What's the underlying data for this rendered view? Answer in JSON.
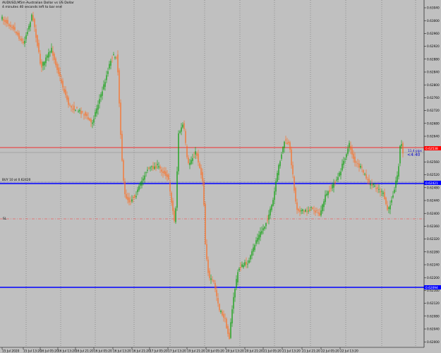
{
  "window": {
    "symbol_line": "AUDUSD,M5m Australian Dollar vs US Dollar",
    "countdown_line": "4 minutes 40 seconds left to bar end"
  },
  "price_axis": {
    "labels": [
      "0.63040",
      "0.63000",
      "0.62960",
      "0.62920",
      "0.62880",
      "0.62840",
      "0.62800",
      "0.62760",
      "0.62720",
      "0.62680",
      "0.62640",
      "0.62600",
      "0.62560",
      "0.62520",
      "0.62480",
      "0.62440",
      "0.62400",
      "0.62360",
      "0.62320",
      "0.62280",
      "0.62240",
      "0.62200",
      "0.62160",
      "0.62120",
      "0.62080",
      "0.62040",
      "0.62000"
    ],
    "current_price_tag": "0.62538",
    "level_tag_1": "0.62421",
    "level_tag_2": "0.62094"
  },
  "time_axis": {
    "labels": [
      "15 Jul 2020",
      "15 Jul 13:20",
      "16 Jul 05:20",
      "16 Jul 13:20",
      "16 Jul 21:20",
      "16 Jul 05:20",
      "16 Jul 13:20",
      "16 Jul 21:20",
      "17 Jul 05:20",
      "17 Jul 13:20",
      "19 Jul 21:20",
      "20 Jul 05:20",
      "20 Jul 13:20",
      "20 Jul 21:20",
      "21 Jul 05:20",
      "21 Jul 13:20",
      "21 Jul 21:20",
      "22 Jul 05:20",
      "22 Jul 13:20"
    ]
  },
  "annotations": {
    "order_label": "BUY 10 at 0.62420",
    "sl_label": "SL",
    "spread_label": "11.4 pips",
    "timer_label": "<4:40"
  },
  "colors": {
    "background": "#c0c0c0",
    "bull_candle": "#00a000",
    "bear_candle": "#ff6a1a",
    "current_price_line": "#ff0000",
    "order_line": "#0000ff",
    "sl_line": "#ff3030",
    "grid": "#606060"
  }
}
